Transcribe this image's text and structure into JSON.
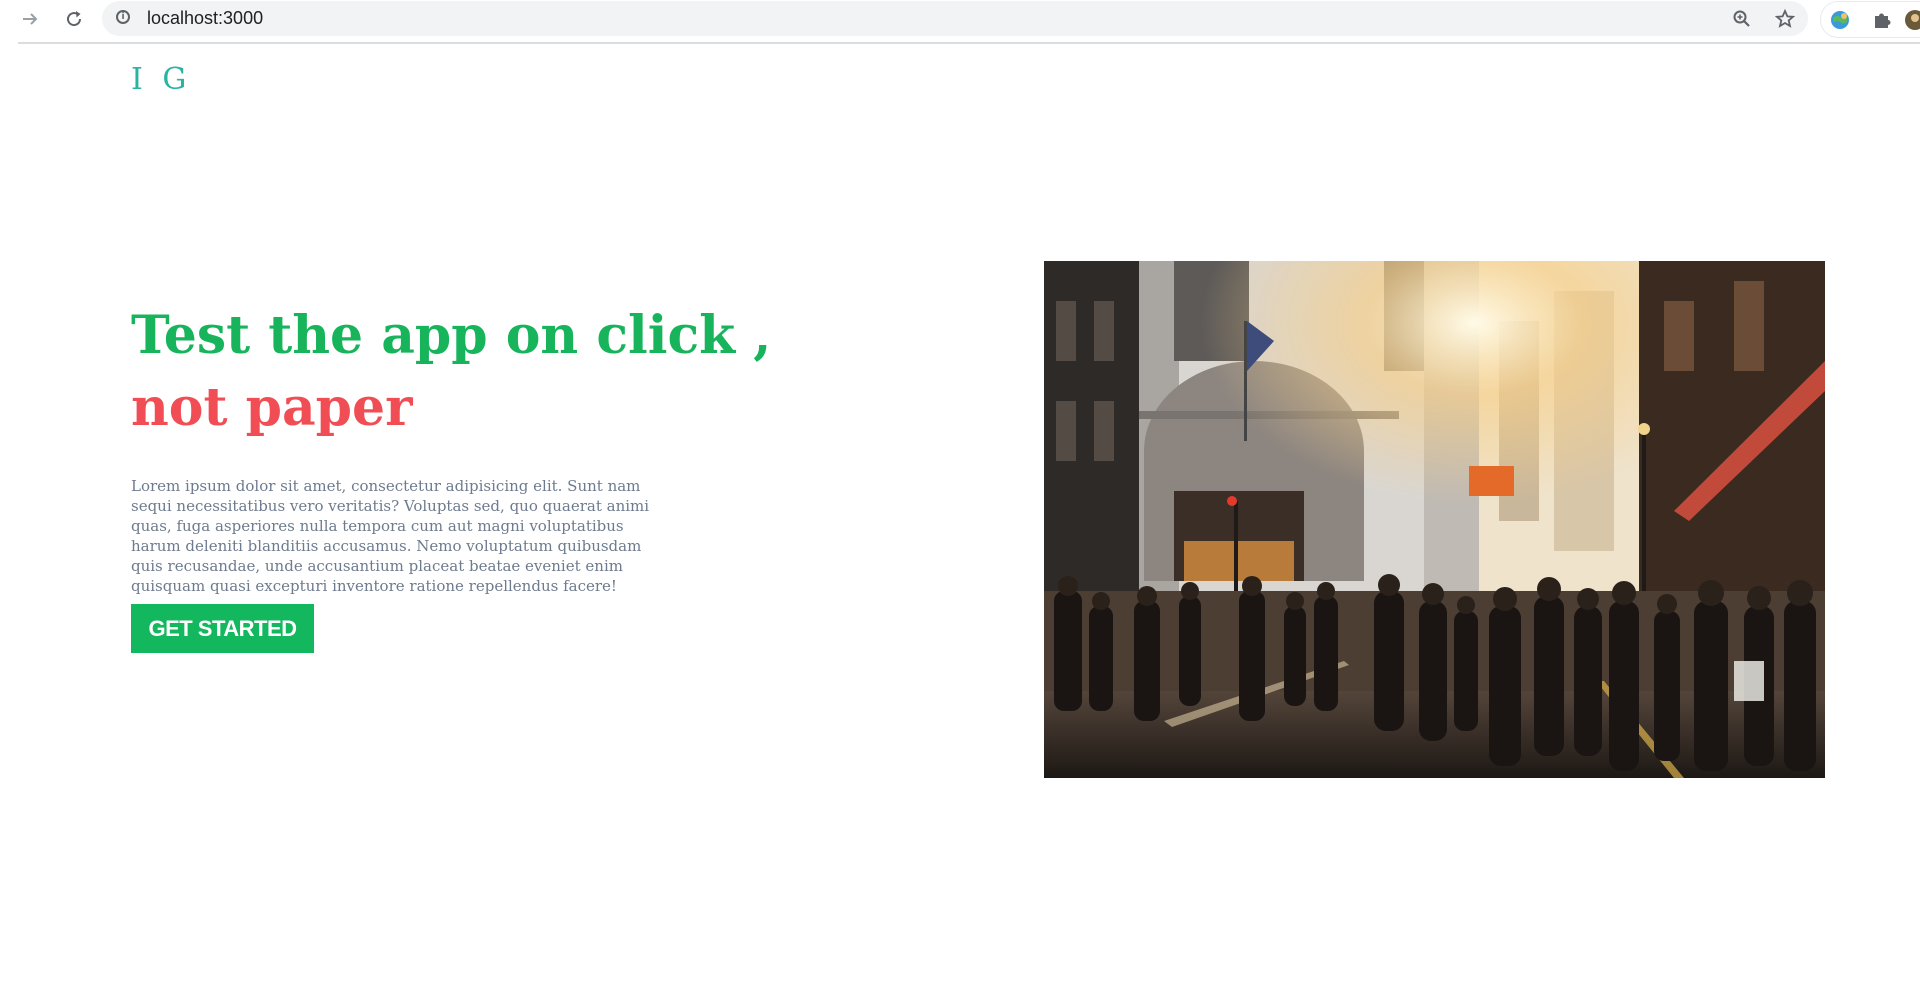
{
  "browser": {
    "url": "localhost:3000",
    "icons": {
      "forward": "arrow-right-icon",
      "reload": "reload-icon",
      "info": "info-icon",
      "zoom": "zoom-in-icon",
      "bookmark": "star-icon",
      "extension": "extension-icon",
      "extensions_menu": "puzzle-icon"
    }
  },
  "page": {
    "logo": "I G",
    "headline_line1": "Test the app on click ,",
    "headline_line2": "not paper",
    "body": "Lorem ipsum dolor sit amet, consectetur adipisicing elit. Sunt nam sequi necessitatibus vero veritatis? Voluptas sed, quo quaerat animi quas, fuga asperiores nulla tempora cum aut magni voluptatibus harum deleniti blanditiis accusamus. Nemo voluptatum quibusdam quis recusandae, unde accusantium placeat beatae eveniet enim quisquam quasi excepturi inventore ratione repellendus facere!",
    "cta_label": "GET STARTED",
    "hero_image": "city-street-crowd-photo"
  },
  "colors": {
    "logo": "#2bb3a2",
    "headline_primary": "#17b45c",
    "headline_accent": "#f04e54",
    "body_text": "#6e7b8e",
    "cta_background": "#13b85e"
  }
}
